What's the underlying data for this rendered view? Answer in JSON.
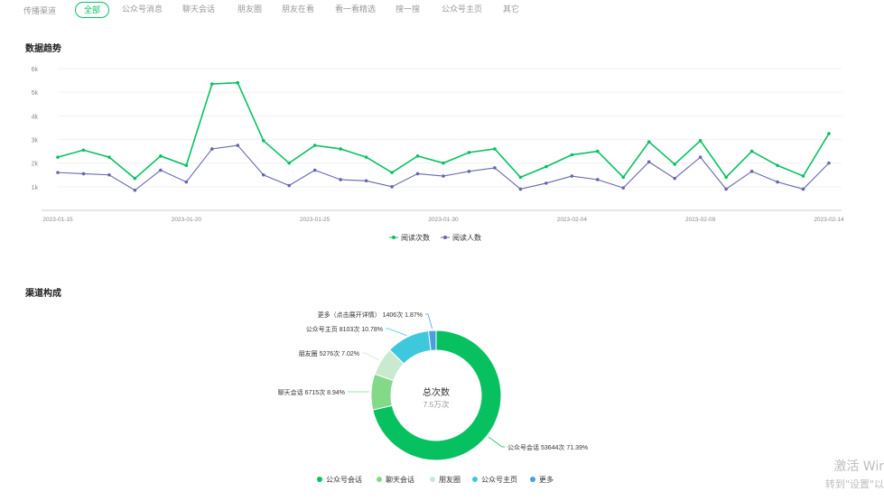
{
  "filter": {
    "label": "传播渠道",
    "tabs": [
      "全部",
      "公众号消息",
      "聊天会话",
      "朋友圈",
      "朋友在看",
      "看一看精选",
      "搜一搜",
      "公众号主页",
      "其它"
    ],
    "active_index": 0
  },
  "sections": {
    "trend_title": "数据趋势",
    "channel_title": "渠道构成"
  },
  "chart_data": [
    {
      "type": "line",
      "x_ticks": [
        "2023-01-15",
        "2023-01-20",
        "2023-01-25",
        "2023-01-30",
        "2023-02-04",
        "2023-02-09",
        "2023-02-14"
      ],
      "y_ticks": [
        "1k",
        "2k",
        "3k",
        "4k",
        "5k",
        "6k"
      ],
      "ylim": [
        0,
        6000
      ],
      "x_dates": [
        "2023-01-15",
        "2023-01-16",
        "2023-01-17",
        "2023-01-18",
        "2023-01-19",
        "2023-01-20",
        "2023-01-21",
        "2023-01-22",
        "2023-01-23",
        "2023-01-24",
        "2023-01-25",
        "2023-01-26",
        "2023-01-27",
        "2023-01-28",
        "2023-01-29",
        "2023-01-30",
        "2023-01-31",
        "2023-02-01",
        "2023-02-02",
        "2023-02-03",
        "2023-02-04",
        "2023-02-05",
        "2023-02-06",
        "2023-02-07",
        "2023-02-08",
        "2023-02-09",
        "2023-02-10",
        "2023-02-11",
        "2023-02-12",
        "2023-02-13",
        "2023-02-14"
      ],
      "series": [
        {
          "name": "阅读次数",
          "color": "#07c160",
          "values": [
            2250,
            2550,
            2250,
            1350,
            2300,
            1900,
            5350,
            5400,
            2950,
            2000,
            2750,
            2600,
            2250,
            1600,
            2300,
            2000,
            2450,
            2600,
            1400,
            1850,
            2350,
            2500,
            1400,
            2900,
            1950,
            2950,
            1400,
            2500,
            1900,
            1450,
            3250
          ]
        },
        {
          "name": "阅读人数",
          "color": "#6467b0",
          "values": [
            1600,
            1550,
            1500,
            850,
            1700,
            1200,
            2600,
            2750,
            1500,
            1050,
            1700,
            1300,
            1250,
            1000,
            1550,
            1450,
            1650,
            1800,
            900,
            1150,
            1450,
            1300,
            950,
            2050,
            1350,
            2250,
            900,
            1650,
            1200,
            900,
            2000
          ]
        }
      ]
    },
    {
      "type": "pie",
      "center_title": "总次数",
      "center_value": "7.5万次",
      "slices": [
        {
          "name": "公众号会话",
          "value": 53644,
          "label": "公众号会话 53644次 71.39%",
          "color": "#07c160"
        },
        {
          "name": "聊天会话",
          "value": 6715,
          "label": "聊天会话 6715次 8.94%",
          "color": "#84d989"
        },
        {
          "name": "朋友圈",
          "value": 5276,
          "label": "朋友圈 5276次 7.02%",
          "color": "#c8ebd0"
        },
        {
          "name": "公众号主页",
          "value": 8103,
          "label": "公众号主页 8103次 10.78%",
          "color": "#3ec8dd"
        },
        {
          "name": "更多",
          "value": 1406,
          "label": "更多（点击展开详情） 1406次 1.87%",
          "color": "#4a9fe0"
        }
      ]
    }
  ],
  "watermark": {
    "line1": "激活 Wir",
    "line2": "转到\"设置\"以"
  }
}
